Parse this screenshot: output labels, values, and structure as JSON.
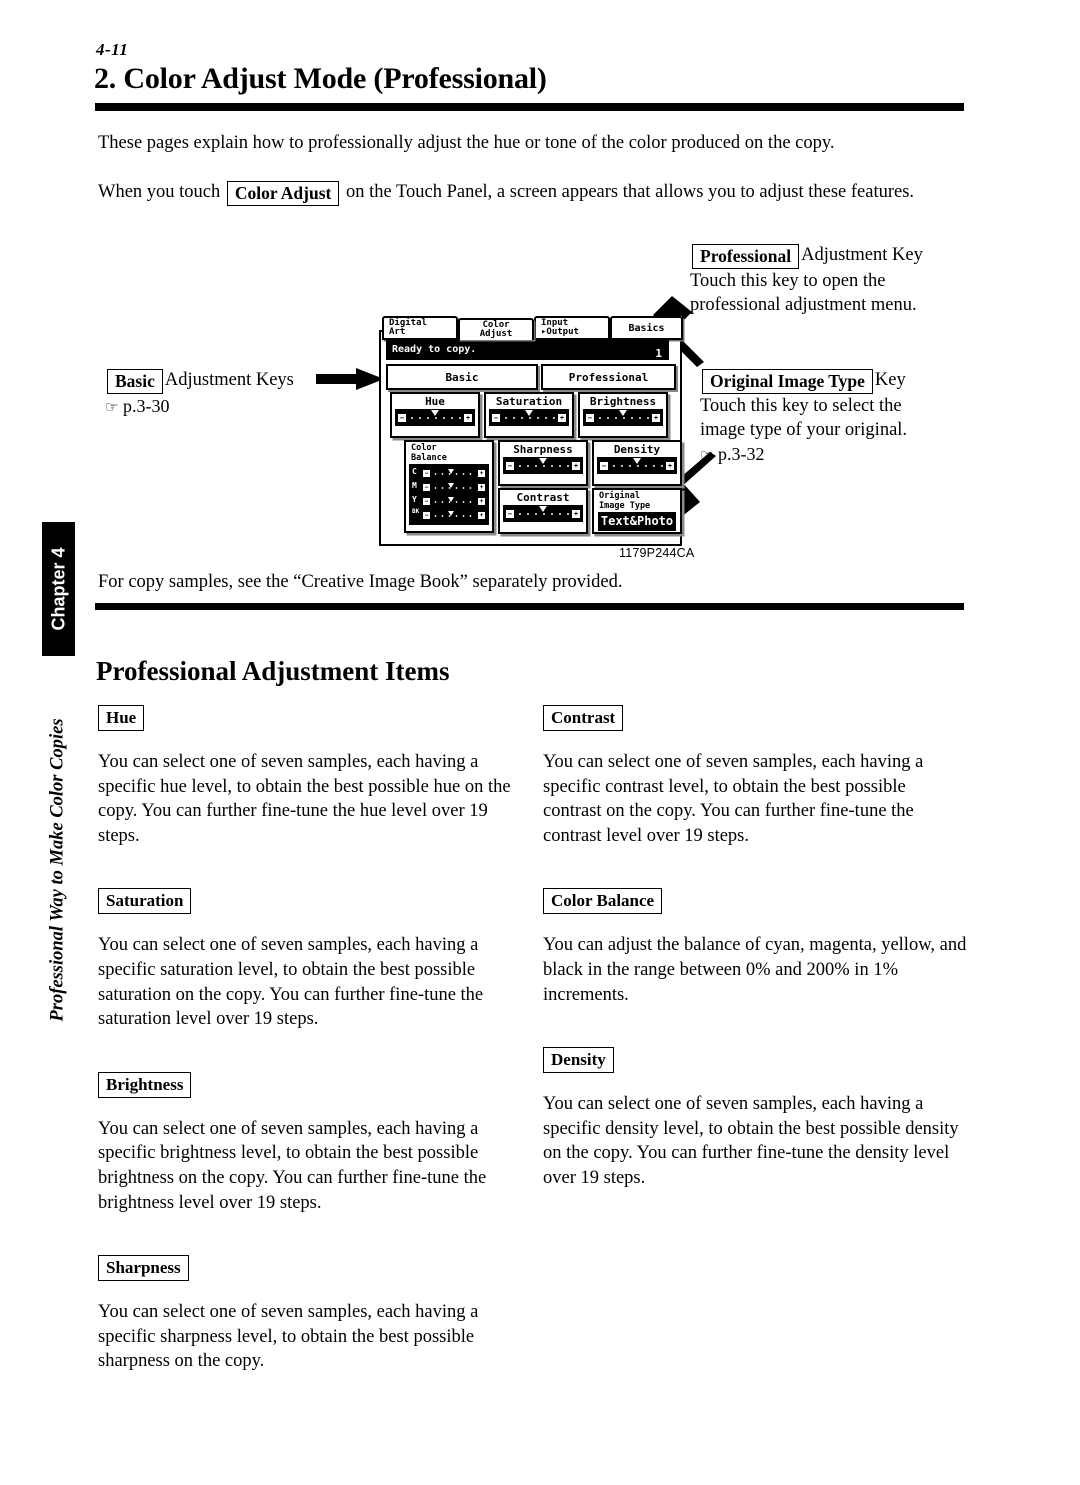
{
  "page": {
    "folio": "4-11",
    "title": "2. Color Adjust Mode (Professional)",
    "figure_caption": "1179P244CA"
  },
  "intro": {
    "line1": "These pages explain how to professionally adjust the hue or tone of the color produced on the copy.",
    "line2_before": "When you touch",
    "line2_key": "Color Adjust",
    "line2_after": "on the Touch Panel, a screen appears that allows you to adjust these features.",
    "closing": "For copy samples, see the “Creative Image Book” separately provided."
  },
  "callouts": {
    "professional": {
      "key": "Professional",
      "key_suffix": "Adjustment Key",
      "line1": "Touch this key to open the",
      "line2": "professional adjustment menu."
    },
    "original_image_type": {
      "key": "Original Image Type",
      "key_suffix": "Key",
      "line1": "Touch this key to select the",
      "line2": "image type of your original.",
      "pageref_icon": "☞",
      "pageref": "p.3-32"
    },
    "basic": {
      "key": "Basic",
      "key_suffix": "Adjustment Keys",
      "pageref_icon": "☞",
      "pageref": "p.3-30"
    }
  },
  "panel": {
    "tabs": [
      {
        "id": "digital-art",
        "line1": "Digital",
        "line2": "Art"
      },
      {
        "id": "color-adjust",
        "line1": "Color",
        "line2": "Adjust"
      },
      {
        "id": "input-output",
        "line1": "Input",
        "line2": "▸Output"
      },
      {
        "id": "basics",
        "line1": "Basics",
        "line2": ""
      }
    ],
    "status_text": "Ready to copy.",
    "status_number": "1",
    "subtabs": [
      {
        "id": "basic",
        "label": "Basic"
      },
      {
        "id": "professional",
        "label": "Professional"
      }
    ],
    "cells": [
      {
        "id": "hue",
        "label": "Hue",
        "type": "slider"
      },
      {
        "id": "saturation",
        "label": "Saturation",
        "type": "slider"
      },
      {
        "id": "brightness",
        "label": "Brightness",
        "type": "slider"
      },
      {
        "id": "color-balance",
        "label_line1": "Color",
        "label_line2": "Balance",
        "type": "multi-slider",
        "rows": [
          "C",
          "M",
          "Y",
          "BK"
        ]
      },
      {
        "id": "sharpness",
        "label": "Sharpness",
        "type": "slider"
      },
      {
        "id": "density",
        "label": "Density",
        "type": "slider"
      },
      {
        "id": "contrast",
        "label": "Contrast",
        "type": "slider"
      },
      {
        "id": "original-image-type",
        "label_line1": "Original",
        "label_line2": "Image Type",
        "type": "value",
        "value": "Text&Photo"
      }
    ],
    "minus_glyph": "−",
    "plus_glyph": "+"
  },
  "section": {
    "heading": "Professional Adjustment Items"
  },
  "items_left": [
    {
      "label": "Hue",
      "body": "You can select one of seven samples, each having a specific hue level, to obtain the best possible hue on the copy. You can further fine-tune the hue level over 19 steps."
    },
    {
      "label": "Saturation",
      "body": "You can select one of seven samples, each having a specific saturation level, to obtain the best possible saturation on the copy. You can further fine-tune the saturation level over 19 steps."
    },
    {
      "label": "Brightness",
      "body": "You can select one of seven samples, each having a specific brightness level, to obtain the best possible brightness on the copy. You can further fine-tune the brightness level over 19 steps."
    },
    {
      "label": "Sharpness",
      "body": "You can select one of seven samples, each having a specific sharpness level, to obtain the best possible sharpness on the copy."
    }
  ],
  "items_right": [
    {
      "label": "Contrast",
      "body": "You can select one of seven samples, each having a specific contrast level, to obtain the best possible contrast on the copy. You can further fine-tune the contrast level over 19 steps."
    },
    {
      "label": "Color Balance",
      "body": "You can adjust the balance of cyan, magenta, yellow, and black in the range between 0% and 200% in 1% increments."
    },
    {
      "label": "Density",
      "body": "You can select one of seven samples, each having a specific density level, to obtain the best possible density on the copy. You can further fine-tune the density level over 19 steps."
    }
  ],
  "sidebar": {
    "chapter": "Chapter 4",
    "running_title": "Professional Way to Make Color Copies"
  }
}
